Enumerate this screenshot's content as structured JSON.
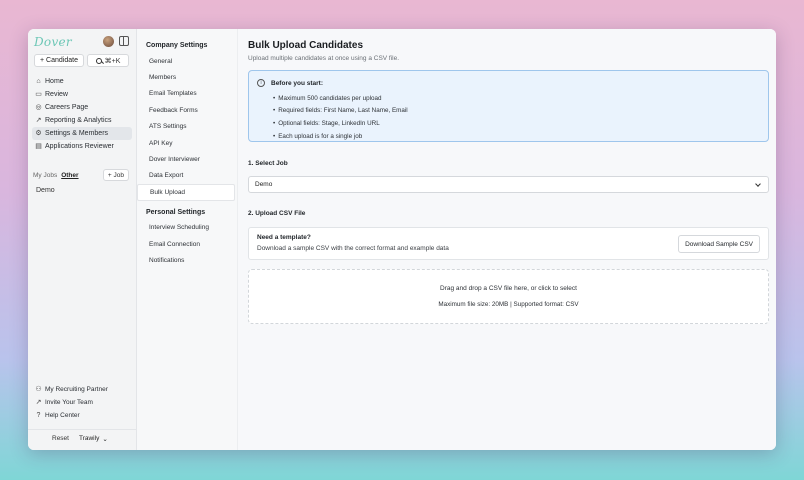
{
  "app": {
    "logo": "Dover"
  },
  "sidebar": {
    "candidate_button": "+ Candidate",
    "search_shortcut": "⌘+K",
    "items": [
      {
        "label": "Home",
        "icon": "home-icon"
      },
      {
        "label": "Review",
        "icon": "review-icon"
      },
      {
        "label": "Careers Page",
        "icon": "globe-icon"
      },
      {
        "label": "Reporting & Analytics",
        "icon": "chart-icon"
      },
      {
        "label": "Settings & Members",
        "icon": "gear-icon"
      },
      {
        "label": "Applications Reviewer",
        "icon": "reviewer-icon"
      }
    ],
    "jobs_tabs": {
      "my_jobs": "My Jobs",
      "other": "Other"
    },
    "add_job_button": "+ Job",
    "job_demo": "Demo",
    "bottom_items": [
      {
        "label": "My Recruiting Partner",
        "icon": "partner-icon"
      },
      {
        "label": "Invite Your Team",
        "icon": "invite-icon"
      },
      {
        "label": "Help Center",
        "icon": "help-icon"
      }
    ],
    "footer": {
      "reset": "Reset",
      "company": "Trawily"
    }
  },
  "settings_nav": {
    "company_title": "Company Settings",
    "company_items": [
      "General",
      "Members",
      "Email Templates",
      "Feedback Forms",
      "ATS Settings",
      "API Key",
      "Dover Interviewer",
      "Data Export",
      "Bulk Upload"
    ],
    "personal_title": "Personal Settings",
    "personal_items": [
      "Interview Scheduling",
      "Email Connection",
      "Notifications"
    ]
  },
  "main": {
    "title": "Bulk Upload Candidates",
    "subtitle": "Upload multiple candidates at once using a CSV file.",
    "info": {
      "title": "Before you start:",
      "items": [
        "Maximum 500 candidates per upload",
        "Required fields: First Name, Last Name, Email",
        "Optional fields: Stage, LinkedIn URL",
        "Each upload is for a single job"
      ]
    },
    "step1_label": "1. Select Job",
    "job_select_value": "Demo",
    "step2_label": "2. Upload CSV File",
    "template": {
      "title": "Need a template?",
      "description": "Download a sample CSV with the correct format and example data",
      "button": "Download Sample CSV"
    },
    "drop_zone": {
      "primary": "Drag and drop a CSV file here, or click to select",
      "secondary": "Maximum file size: 20MB | Supported format: CSV"
    }
  },
  "colors": {
    "brand": "#6dc7b6",
    "info_bg": "#eaf3fd",
    "info_border": "#9fc6ec"
  }
}
